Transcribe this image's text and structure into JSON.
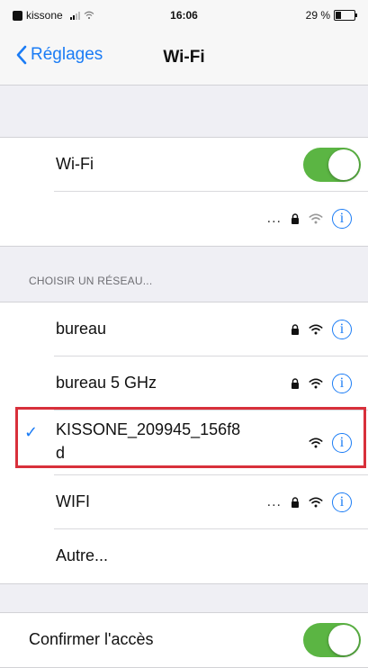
{
  "status_bar": {
    "carrier": "kissone",
    "time": "16:06",
    "battery_percent": "29 %",
    "battery_level": 0.29
  },
  "nav": {
    "back_label": "Réglages",
    "title": "Wi-Fi"
  },
  "wifi": {
    "label": "Wi-Fi",
    "enabled": true,
    "connected_ellipsis": "...",
    "info_glyph": "i"
  },
  "network_section_header": "CHOISIR UN RÉSEAU...",
  "networks": [
    {
      "name": "bureau",
      "locked": true,
      "info": "i"
    },
    {
      "name": "bureau 5 GHz",
      "locked": true,
      "info": "i"
    },
    {
      "name": "KISSONE_209945_156f8\nd",
      "locked": false,
      "selected": true,
      "info": "i"
    },
    {
      "name": "WIFI",
      "locked": true,
      "ellipsis": "...",
      "info": "i"
    }
  ],
  "other_label": "Autre...",
  "confirm": {
    "label": "Confirmer l'accès",
    "enabled": true
  },
  "colors": {
    "accent": "#1b7cf5",
    "toggle_on": "#5bb543",
    "highlight": "#d8303b",
    "background": "#efeff4"
  },
  "icons": [
    "chevron-left-icon",
    "lock-icon",
    "wifi-icon",
    "info-icon",
    "checkmark-icon"
  ]
}
